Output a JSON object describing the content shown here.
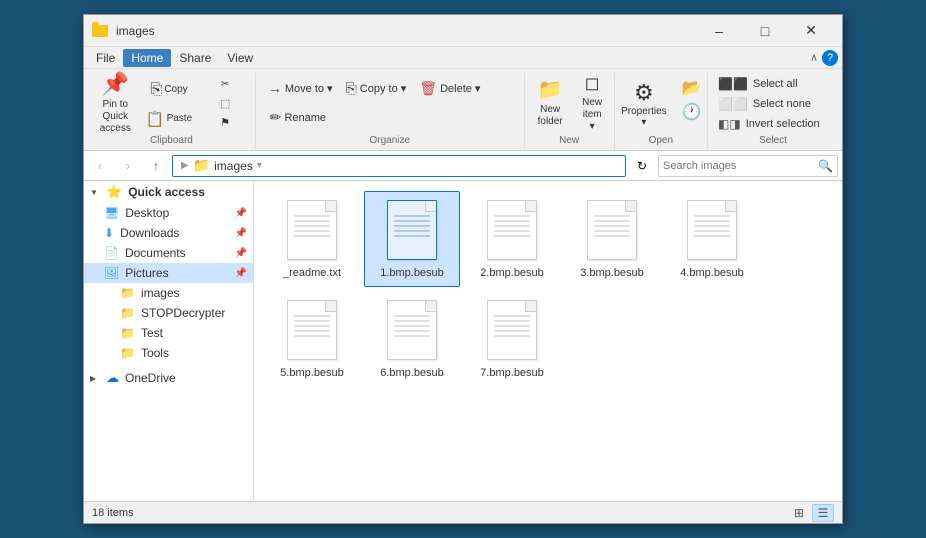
{
  "window": {
    "title": "images",
    "titlebar_icons": [
      "folder-sm"
    ],
    "min_label": "–",
    "max_label": "□",
    "close_label": "✕"
  },
  "menubar": {
    "items": [
      "File",
      "Home",
      "Share",
      "View"
    ],
    "active": "Home",
    "chevron_label": "∧",
    "help_label": "?"
  },
  "ribbon": {
    "groups": [
      {
        "label": "Clipboard",
        "buttons_large": [
          {
            "icon": "📌",
            "label": "Pin to Quick\naccess",
            "name": "pin-quick-access"
          }
        ],
        "buttons_small": [
          {
            "icon": "⎘",
            "label": "Copy",
            "name": "copy-btn"
          },
          {
            "icon": "📋",
            "label": "Paste",
            "name": "paste-btn"
          },
          {
            "icon": "✂",
            "label": "Cut",
            "name": "cut-btn"
          },
          {
            "icon": "⬚",
            "label": "Copy path",
            "name": "copy-path-btn"
          },
          {
            "icon": "⚑",
            "label": "Paste shortcut",
            "name": "paste-shortcut-btn"
          }
        ]
      },
      {
        "label": "Organize",
        "buttons": [
          {
            "icon": "→",
            "label": "Move to ▾",
            "name": "move-to-btn"
          },
          {
            "icon": "⎘",
            "label": "Copy to ▾",
            "name": "copy-to-btn"
          },
          {
            "icon": "🗑",
            "label": "Delete ▾",
            "name": "delete-btn"
          },
          {
            "icon": "✏",
            "label": "Rename",
            "name": "rename-btn"
          }
        ]
      },
      {
        "label": "New",
        "buttons": [
          {
            "icon": "📁",
            "label": "New\nfolder",
            "name": "new-folder-btn"
          },
          {
            "icon": "◻",
            "label": "New\nitem ▾",
            "name": "new-item-btn"
          }
        ]
      },
      {
        "label": "Open",
        "buttons": [
          {
            "icon": "⚙",
            "label": "Properties",
            "name": "properties-btn"
          }
        ]
      },
      {
        "label": "Select",
        "items": [
          {
            "label": "Select all",
            "name": "select-all"
          },
          {
            "label": "Select none",
            "name": "select-none"
          },
          {
            "label": "Invert selection",
            "name": "invert-selection"
          }
        ]
      }
    ]
  },
  "addressbar": {
    "back_label": "‹",
    "forward_label": "›",
    "up_label": "↑",
    "path_parts": [
      "",
      "images"
    ],
    "path_display": "images",
    "refresh_label": "↻",
    "search_placeholder": "Search images",
    "search_label": "🔍"
  },
  "sidebar": {
    "items": [
      {
        "label": "Quick access",
        "icon": "⭐",
        "indent": 0,
        "bold": true,
        "expanded": true,
        "name": "quick-access"
      },
      {
        "label": "Desktop",
        "icon": "🖥",
        "indent": 1,
        "pin": true,
        "name": "desktop"
      },
      {
        "label": "Downloads",
        "icon": "⬇",
        "indent": 1,
        "pin": true,
        "name": "downloads"
      },
      {
        "label": "Documents",
        "icon": "📄",
        "indent": 1,
        "pin": true,
        "name": "documents"
      },
      {
        "label": "Pictures",
        "icon": "🖼",
        "indent": 1,
        "pin": true,
        "active": true,
        "name": "pictures"
      },
      {
        "label": "images",
        "icon": "📁",
        "indent": 2,
        "name": "images-folder"
      },
      {
        "label": "STOPDecrypter",
        "icon": "📁",
        "indent": 2,
        "name": "stopdecrypter"
      },
      {
        "label": "Test",
        "icon": "📁",
        "indent": 2,
        "name": "test-folder"
      },
      {
        "label": "Tools",
        "icon": "📁",
        "indent": 2,
        "name": "tools-folder"
      },
      {
        "label": "OneDrive",
        "icon": "☁",
        "indent": 0,
        "name": "onedrive"
      }
    ]
  },
  "files": [
    {
      "name": "_readme.txt",
      "type": "txt",
      "selected": false
    },
    {
      "name": "1.bmp.besub",
      "type": "besub",
      "selected": true
    },
    {
      "name": "2.bmp.besub",
      "type": "besub",
      "selected": false
    },
    {
      "name": "3.bmp.besub",
      "type": "besub",
      "selected": false
    },
    {
      "name": "4.bmp.besub",
      "type": "besub",
      "selected": false
    },
    {
      "name": "5.bmp.besub",
      "type": "besub",
      "selected": false
    },
    {
      "name": "6.bmp.besub",
      "type": "besub",
      "selected": false
    },
    {
      "name": "7.bmp.besub",
      "type": "besub",
      "selected": false
    }
  ],
  "statusbar": {
    "count_label": "18 items",
    "view_grid_label": "⊞",
    "view_list_label": "☰"
  }
}
